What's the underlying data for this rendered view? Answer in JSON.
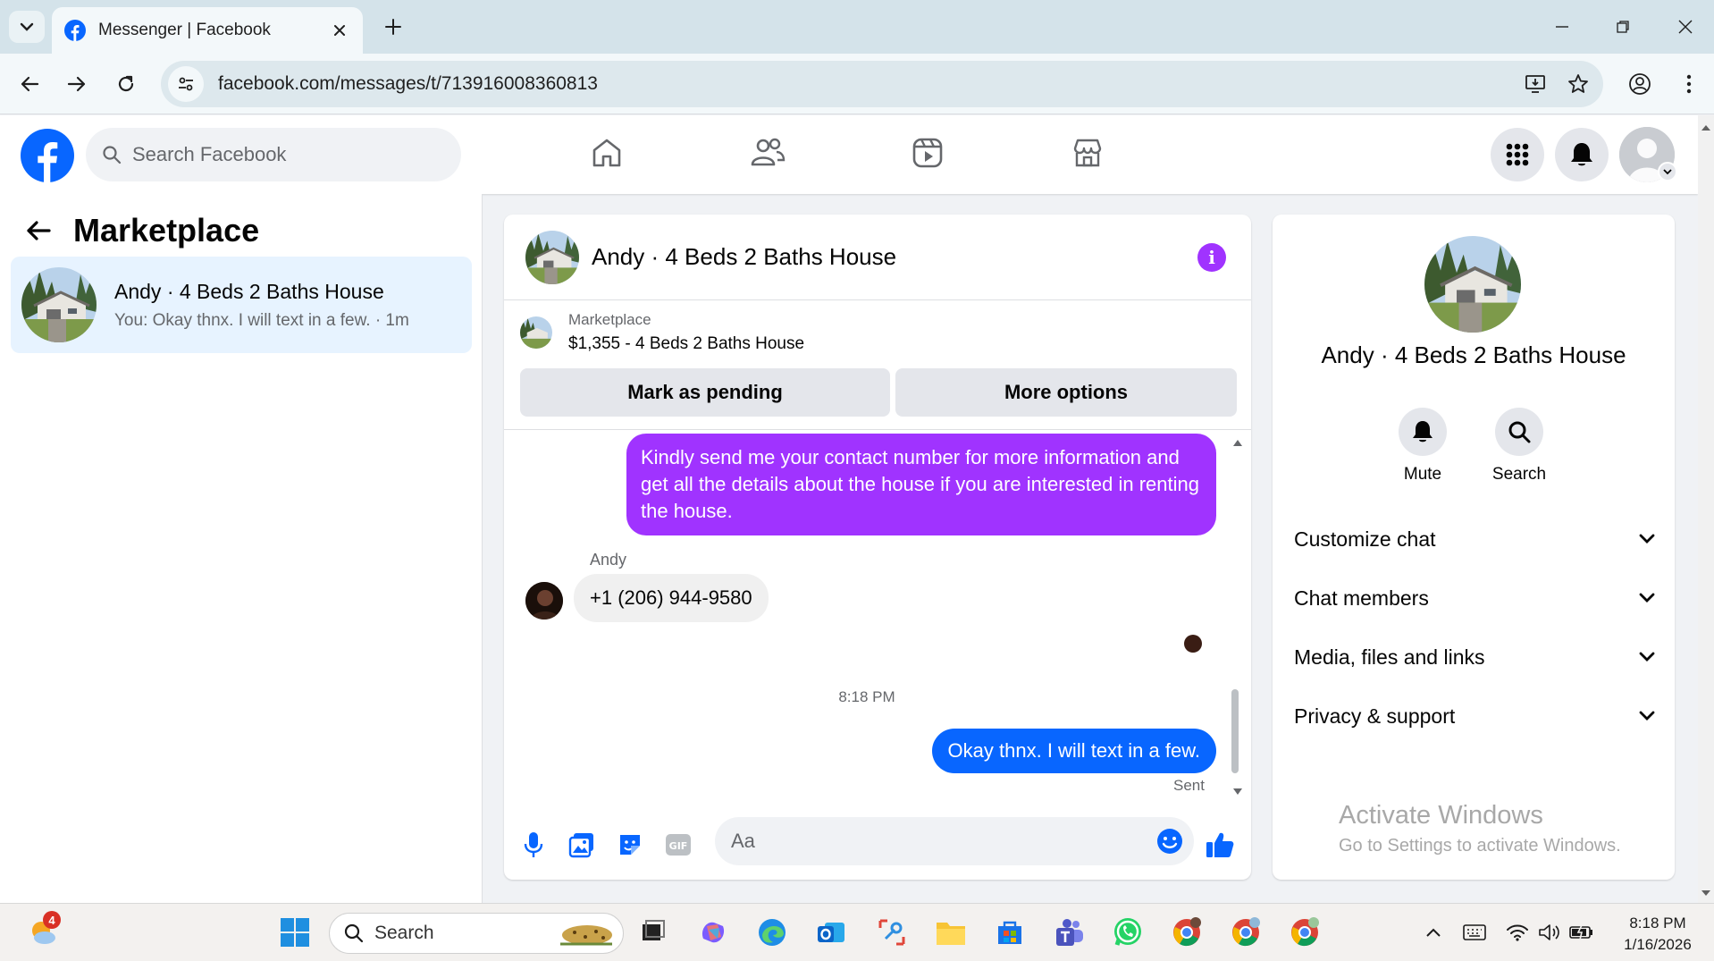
{
  "browser": {
    "tab_title": "Messenger | Facebook",
    "url": "facebook.com/messages/t/713916008360813"
  },
  "fb": {
    "search_placeholder": "Search Facebook"
  },
  "sidebar": {
    "title": "Marketplace",
    "conversation": {
      "name": "Andy · 4 Beds 2 Baths House",
      "snippet": "You: Okay thnx. I will text in a few. · 1m"
    }
  },
  "chat": {
    "title": "Andy · 4 Beds 2 Baths House",
    "marketplace_label": "Marketplace",
    "listing": "$1,355 - 4 Beds 2 Baths House",
    "mark_pending_label": "Mark as pending",
    "more_options_label": "More options",
    "messages": {
      "out1": "Kindly send me your contact number for more information and get all the details about the house if you are interested in renting the house.",
      "sender": "Andy",
      "in1": "+1 (206) 944-9580",
      "time": "8:18 PM",
      "out2": "Okay thnx. I will text in a few.",
      "status": "Sent"
    },
    "composer_placeholder": "Aa"
  },
  "details": {
    "name": "Andy · 4 Beds 2 Baths House",
    "mute_label": "Mute",
    "search_label": "Search",
    "sections": [
      "Customize chat",
      "Chat members",
      "Media, files and links",
      "Privacy & support"
    ]
  },
  "watermark": {
    "line1": "Activate Windows",
    "line2": "Go to Settings to activate Windows."
  },
  "taskbar": {
    "search_label": "Search",
    "time": "8:18 PM",
    "date": "1/16/2026",
    "weather_badge": "4"
  },
  "colors": {
    "fb_blue": "#0866ff",
    "purple_bubble": "#a033ff",
    "selected_row": "#e7f3ff"
  }
}
